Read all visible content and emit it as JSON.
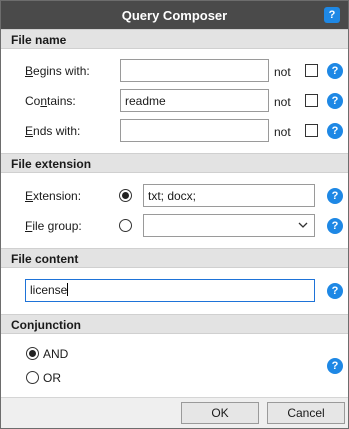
{
  "window": {
    "title": "Query Composer",
    "help_icon": "help-icon"
  },
  "file_name": {
    "header": "File name",
    "rows": [
      {
        "label_accel": "B",
        "label_rest": "egins with:",
        "value": "",
        "not_label": "not"
      },
      {
        "label_pre": "Co",
        "label_accel": "n",
        "label_rest": "tains:",
        "value": "readme",
        "not_label": "not"
      },
      {
        "label_accel": "E",
        "label_rest": "nds with:",
        "value": "",
        "not_label": "not"
      }
    ]
  },
  "file_extension": {
    "header": "File extension",
    "extension": {
      "label_accel": "E",
      "label_rest": "xtension:",
      "value": "txt; docx;",
      "selected": true
    },
    "file_group": {
      "label_accel": "F",
      "label_rest": "ile group:",
      "value": "",
      "selected": false
    }
  },
  "file_content": {
    "header": "File content",
    "value": "license"
  },
  "conjunction": {
    "header": "Conjunction",
    "options": [
      {
        "label": "AND",
        "selected": true
      },
      {
        "label": "OR",
        "selected": false
      }
    ]
  },
  "buttons": {
    "ok": "OK",
    "cancel": "Cancel"
  },
  "colors": {
    "titlebar": "#4a4a4a",
    "accent": "#1e88e5",
    "section": "#e3e3e3"
  }
}
